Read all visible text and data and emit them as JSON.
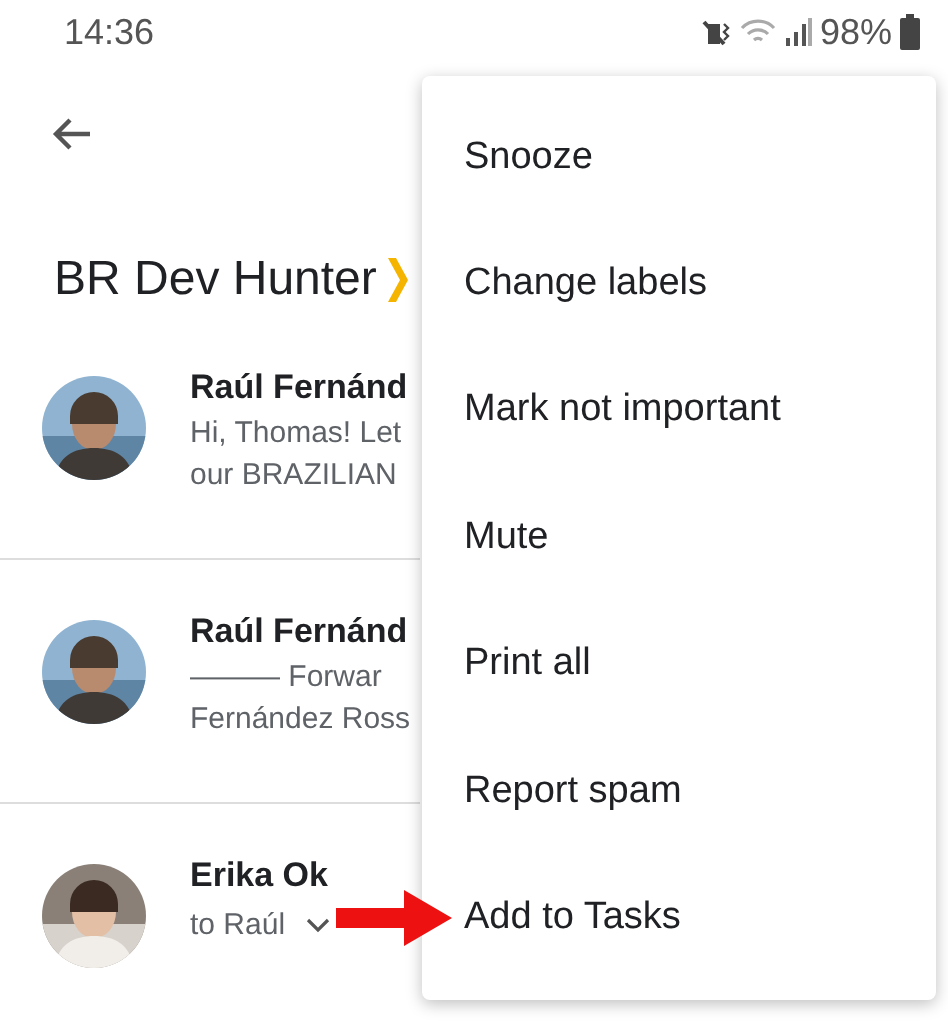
{
  "status_bar": {
    "time": "14:36",
    "battery": "98%"
  },
  "title": "BR Dev Hunter",
  "messages": [
    {
      "sender": "Raúl Fernánd",
      "lines": [
        "Hi, Thomas! Let",
        "our BRAZILIAN"
      ]
    },
    {
      "sender": "Raúl Fernánd",
      "lines": [
        "——— Forwar",
        "Fernández Ross"
      ]
    },
    {
      "sender": "Erika Ok",
      "recipient": "to Raúl"
    }
  ],
  "menu": {
    "items": [
      "Snooze",
      "Change labels",
      "Mark not important",
      "Mute",
      "Print all",
      "Report spam",
      "Add to Tasks"
    ]
  }
}
